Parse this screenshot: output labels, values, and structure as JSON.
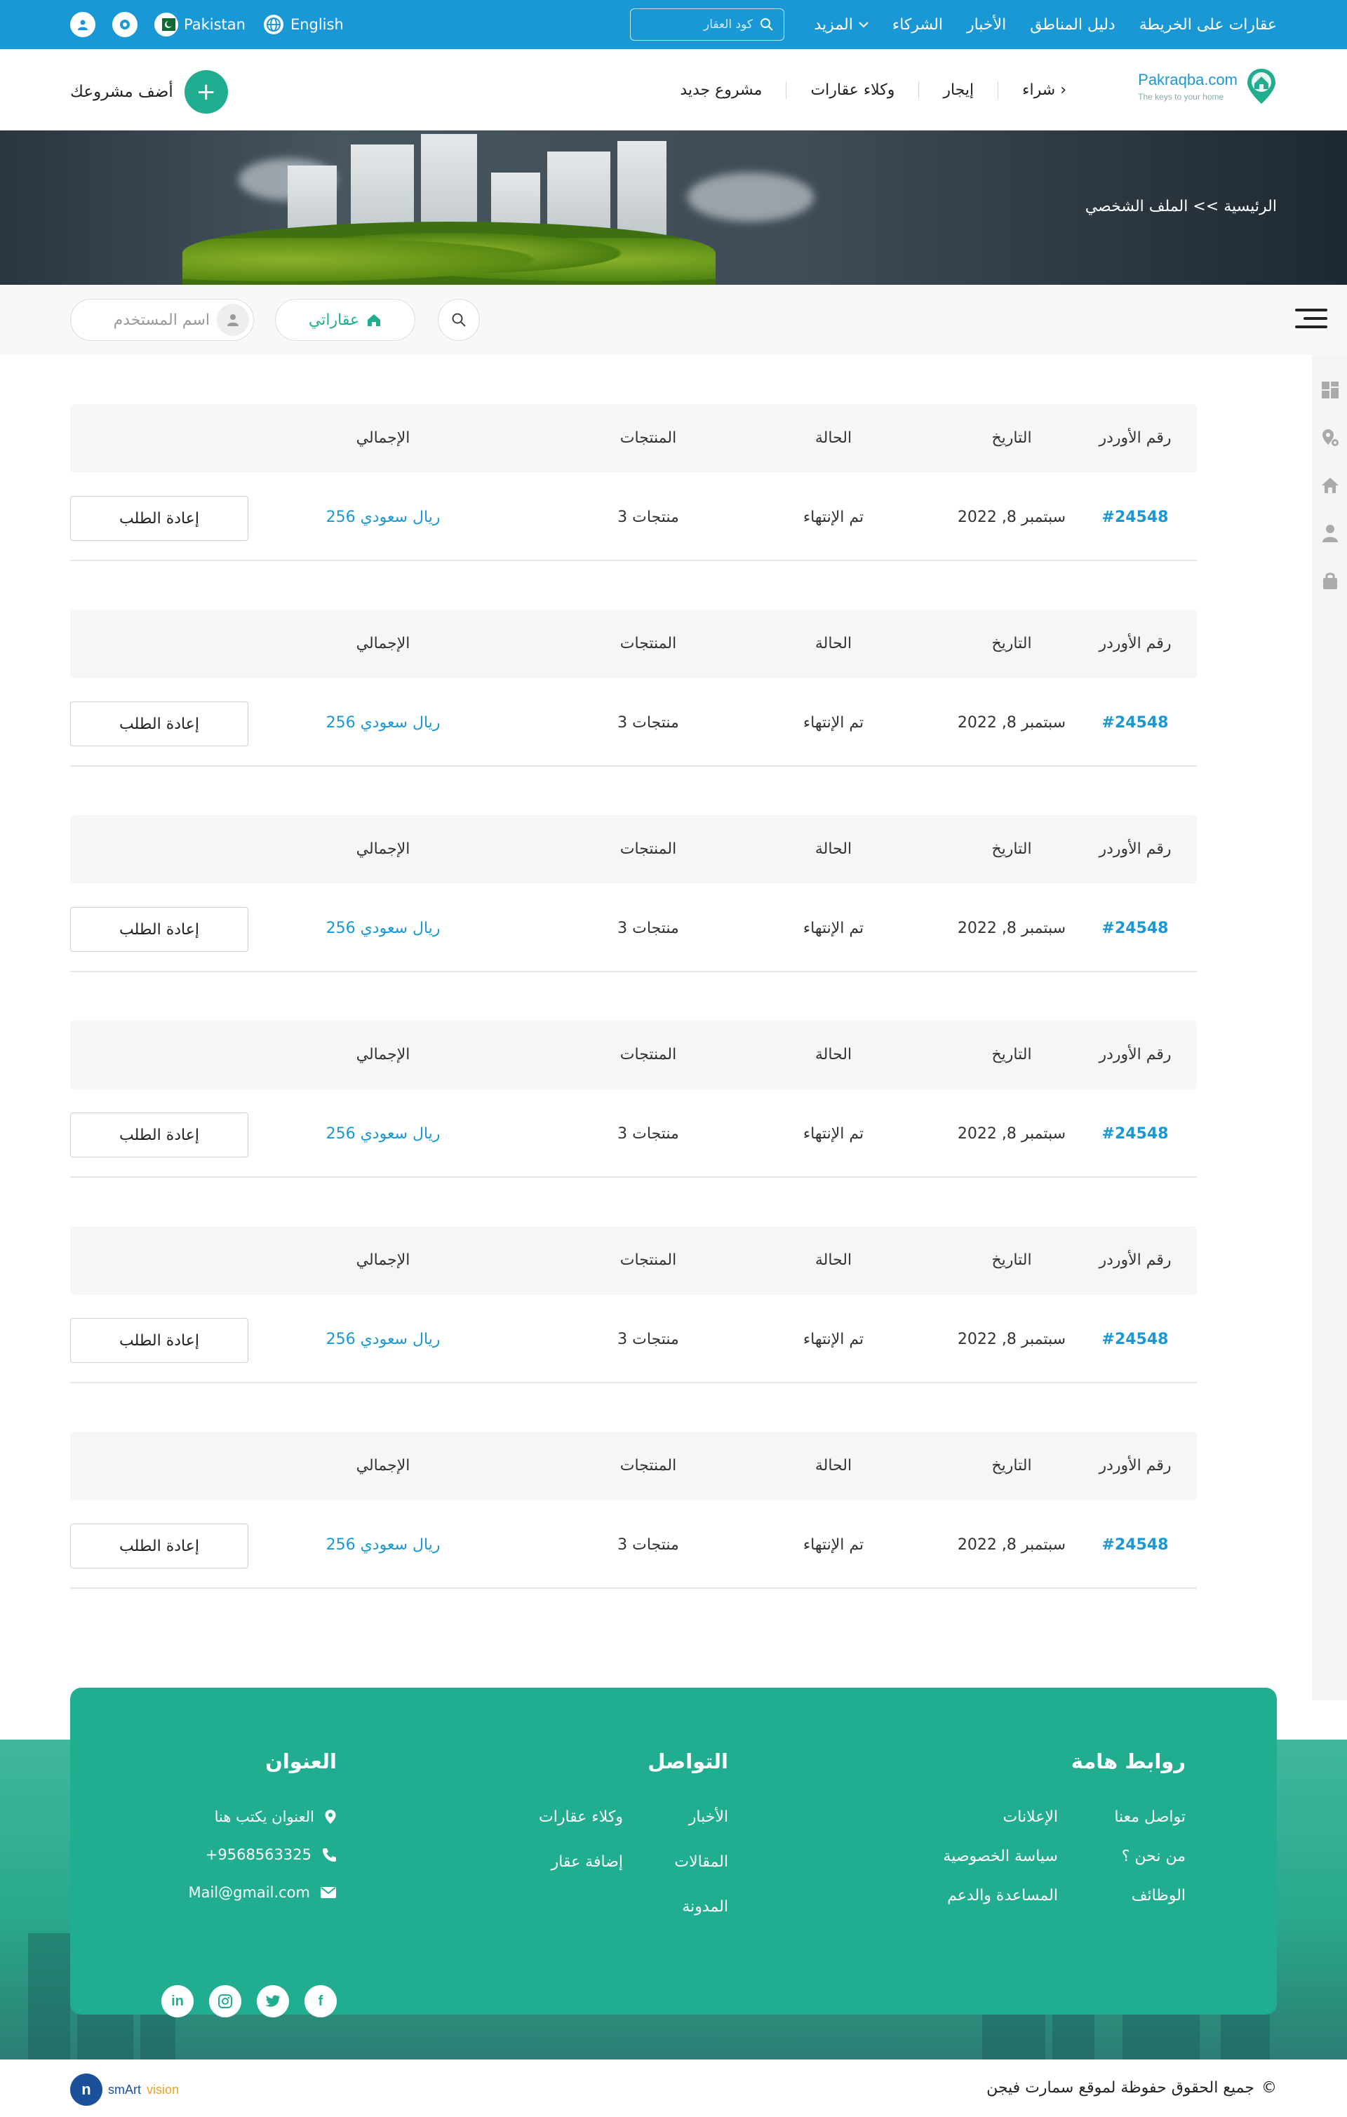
{
  "topbar": {
    "nav": [
      "عقارات على الخريطة",
      "دليل المناطق",
      "الأخبار",
      "الشركاء",
      "المزيد"
    ],
    "code_placeholder": "كود العقار",
    "country": "Pakistan",
    "language": "English",
    "bg_color": "#1a98d5"
  },
  "header": {
    "logo_name": "Pakraqba.com",
    "logo_tagline": "The keys to your home",
    "nav": [
      "شراء",
      "إيجار",
      "وكلاء عقارات",
      "مشروع جديد"
    ],
    "add_project_label": "أضف مشروعك",
    "add_icon": "+"
  },
  "banner": {
    "breadcrumb": "الرئيسية >> الملف الشخصي"
  },
  "toolbar": {
    "my_properties": "عقاراتي",
    "username_placeholder": "اسم المستخدم"
  },
  "orders": {
    "headers": {
      "order_no": "رقم الأوردر",
      "date": "التاريخ",
      "status": "الحالة",
      "products": "المنتجات",
      "total": "الإجمالي"
    },
    "items": [
      {
        "order_no": "#24548",
        "date": "سبتمبر 8, 2022",
        "status": "تم الإنتهاء",
        "products": "3 منتجات",
        "total": "256 ريال سعودي",
        "action": "إعادة الطلب"
      },
      {
        "order_no": "#24548",
        "date": "سبتمبر 8, 2022",
        "status": "تم الإنتهاء",
        "products": "3 منتجات",
        "total": "256 ريال سعودي",
        "action": "إعادة الطلب"
      },
      {
        "order_no": "#24548",
        "date": "سبتمبر 8, 2022",
        "status": "تم الإنتهاء",
        "products": "3 منتجات",
        "total": "256 ريال سعودي",
        "action": "إعادة الطلب"
      },
      {
        "order_no": "#24548",
        "date": "سبتمبر 8, 2022",
        "status": "تم الإنتهاء",
        "products": "3 منتجات",
        "total": "256 ريال سعودي",
        "action": "إعادة الطلب"
      },
      {
        "order_no": "#24548",
        "date": "سبتمبر 8, 2022",
        "status": "تم الإنتهاء",
        "products": "3 منتجات",
        "total": "256 ريال سعودي",
        "action": "إعادة الطلب"
      },
      {
        "order_no": "#24548",
        "date": "سبتمبر 8, 2022",
        "status": "تم الإنتهاء",
        "products": "3 منتجات",
        "total": "256 ريال سعودي",
        "action": "إعادة الطلب"
      }
    ]
  },
  "footer": {
    "links_title": "روابط هامة",
    "links_right": [
      "تواصل معنا",
      "من نحن ؟",
      "الوظائف"
    ],
    "links_left": [
      "الإعلانات",
      "سياسة الخصوصية",
      "المساعدة والدعم"
    ],
    "contact_title": "التواصل",
    "contact_right": [
      "الأخبار",
      "المقالات",
      "المدونة"
    ],
    "contact_left": [
      "وكلاء عقارات",
      "إضافة عقار"
    ],
    "address_title": "العنوان",
    "address": "العنوان يكتب هنا",
    "phone": "+9568563325",
    "email": "Mail@gmail.com",
    "socials": [
      "in",
      "ig",
      "t",
      "f"
    ],
    "accent": "#21ad8f"
  },
  "bottom": {
    "copyright": "جميع الحقوق حفوظة لموقع سمارت فيجن",
    "copyright_icon": "©",
    "brand_sm": "smArt",
    "brand_vision": "vision"
  }
}
